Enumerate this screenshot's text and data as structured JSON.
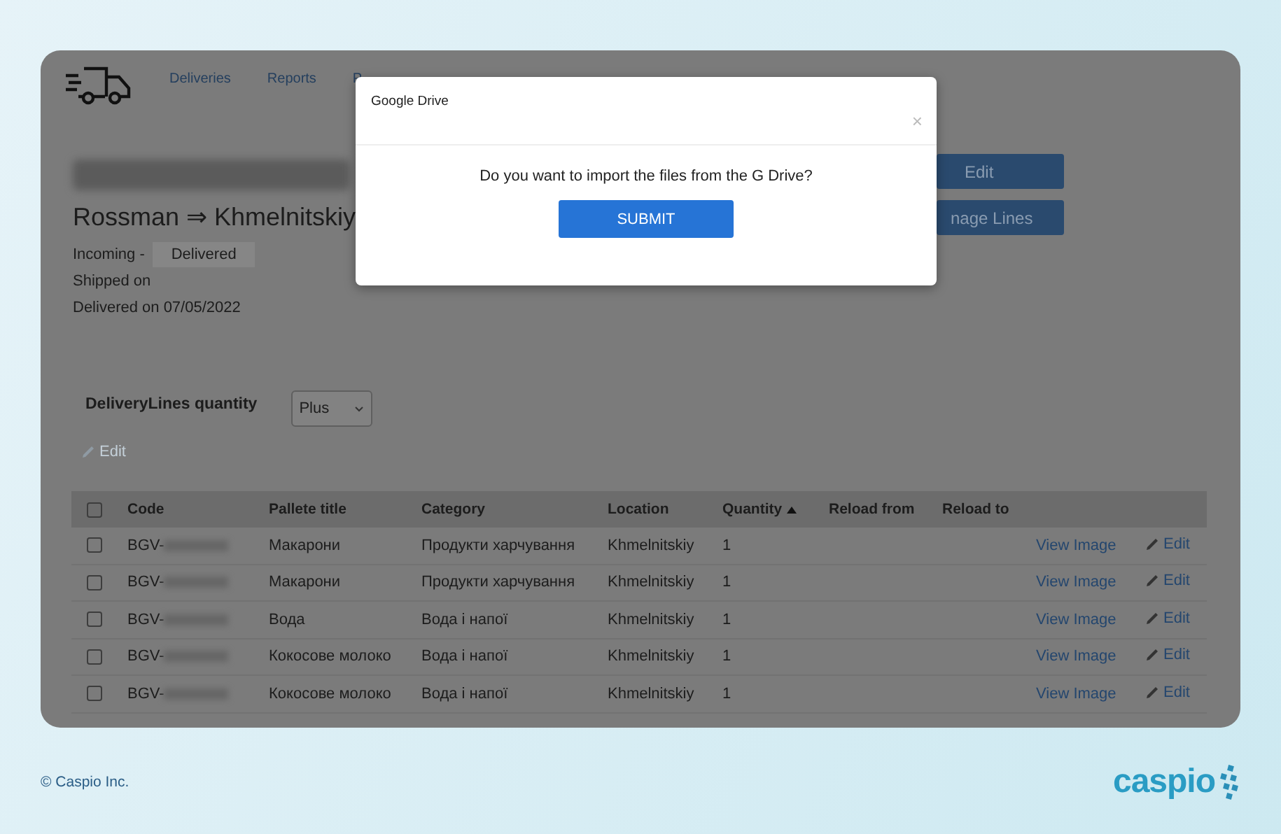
{
  "nav": {
    "items": [
      {
        "label": "Deliveries"
      },
      {
        "label": "Reports"
      },
      {
        "label": "P"
      }
    ]
  },
  "delivery": {
    "route": "Rossman ⇒ Khmelnitskiy",
    "incoming_label": "Incoming -",
    "status": "Delivered",
    "shipped": "Shipped on",
    "delivered": "Delivered on 07/05/2022"
  },
  "actions": [
    "Edit",
    "nage Lines"
  ],
  "lines": {
    "label": "DeliveryLines quantity",
    "select_value": "Plus",
    "edit_link": {
      "label": "Edit",
      "disabled": true
    }
  },
  "table": {
    "columns": [
      {
        "label": "Code",
        "sorted": false
      },
      {
        "label": "Pallete title",
        "sorted": false
      },
      {
        "label": "Category",
        "sorted": false
      },
      {
        "label": "Location",
        "sorted": false
      },
      {
        "label": "Quantity",
        "sorted": true
      },
      {
        "label": "Reload from",
        "sorted": false
      },
      {
        "label": "Reload to",
        "sorted": false
      }
    ],
    "header_checked": false,
    "rows": [
      {
        "checked": false,
        "code": "BGV-",
        "title": "Макарони",
        "category": "Продукти харчування",
        "location": "Khmelnitskiy",
        "quantity": "1",
        "view": "View Image",
        "edit": "Edit"
      },
      {
        "checked": false,
        "code": "BGV-",
        "title": "Макарони",
        "category": "Продукти харчування",
        "location": "Khmelnitskiy",
        "quantity": "1",
        "view": "View Image",
        "edit": "Edit"
      },
      {
        "checked": false,
        "code": "BGV-",
        "title": "Вода",
        "category": "Вода і напої",
        "location": "Khmelnitskiy",
        "quantity": "1",
        "view": "View Image",
        "edit": "Edit"
      },
      {
        "checked": false,
        "code": "BGV-",
        "title": "Кокосове молоко",
        "category": "Вода і напої",
        "location": "Khmelnitskiy",
        "quantity": "1",
        "view": "View Image",
        "edit": "Edit"
      },
      {
        "checked": false,
        "code": "BGV-",
        "title": "Кокосове молоко",
        "category": "Вода і напої",
        "location": "Khmelnitskiy",
        "quantity": "1",
        "view": "View Image",
        "edit": "Edit"
      }
    ]
  },
  "modal": {
    "title": "Google Drive",
    "close": "×",
    "message": "Do you want to import the files from the G Drive?",
    "button": "SUBMIT"
  },
  "footer": {
    "copyright": "© Caspio Inc.",
    "logo": "caspio"
  }
}
